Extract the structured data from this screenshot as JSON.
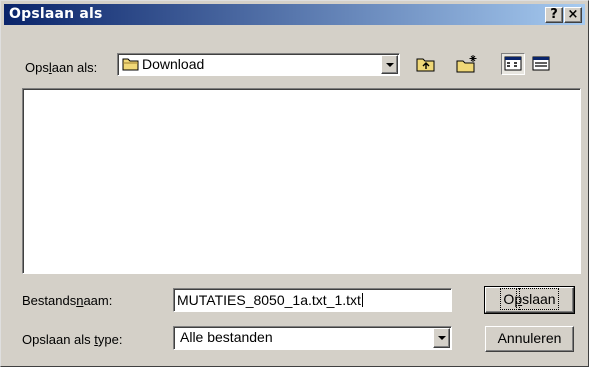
{
  "window": {
    "title": "Opslaan als",
    "help_label": "?",
    "close_label": "×"
  },
  "location": {
    "label_pre": "Ops",
    "label_key": "l",
    "label_post": "aan als:",
    "value": "Download",
    "icon": "folder-icon"
  },
  "toolbar": {
    "up_folder_icon": "up-folder-icon",
    "new_folder_icon": "new-folder-icon",
    "list_view_icon": "list-view-icon",
    "details_view_icon": "details-view-icon"
  },
  "filename": {
    "label_pre": "Bestands",
    "label_key": "n",
    "label_post": "aam:",
    "value": "MUTATIES_8050_1a.txt_1.txt"
  },
  "filetype": {
    "label_pre": "Opslaan als ",
    "label_key": "t",
    "label_post": "ype:",
    "value": "Alle bestanden"
  },
  "buttons": {
    "save_pre": "O",
    "save_key": "p",
    "save_post": "slaan",
    "cancel": "Annuleren"
  },
  "colors": {
    "titlebar_start": "#0a246a",
    "titlebar_end": "#a6caf0",
    "face": "#d4d0c8"
  }
}
